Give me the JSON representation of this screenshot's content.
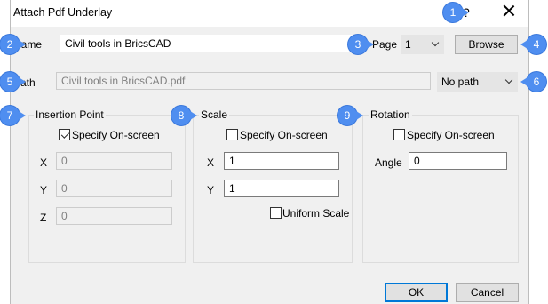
{
  "title": "Attach Pdf Underlay",
  "help_label": "?",
  "name": {
    "label": "Name",
    "value": "Civil tools in BricsCAD"
  },
  "page": {
    "label": "Page",
    "value": "1"
  },
  "browse_label": "Browse",
  "path": {
    "label": "Path",
    "value": "Civil tools in BricsCAD.pdf",
    "type_value": "No path"
  },
  "insertion": {
    "title": "Insertion Point",
    "specify_label": "Specify On-screen",
    "specify_checked": true,
    "x_label": "X",
    "x_value": "0",
    "y_label": "Y",
    "y_value": "0",
    "z_label": "Z",
    "z_value": "0"
  },
  "scale": {
    "title": "Scale",
    "specify_label": "Specify On-screen",
    "specify_checked": false,
    "x_label": "X",
    "x_value": "1",
    "y_label": "Y",
    "y_value": "1",
    "uniform_label": "Uniform Scale",
    "uniform_checked": false
  },
  "rotation": {
    "title": "Rotation",
    "specify_label": "Specify On-screen",
    "specify_checked": false,
    "angle_label": "Angle",
    "angle_value": "0"
  },
  "ok_label": "OK",
  "cancel_label": "Cancel",
  "callouts": [
    "1",
    "2",
    "3",
    "4",
    "5",
    "6",
    "7",
    "8",
    "9"
  ],
  "colors": {
    "callout": "#4f8ef0",
    "focus_border": "#0078d7",
    "dialog_bg": "#f0f0f0"
  }
}
